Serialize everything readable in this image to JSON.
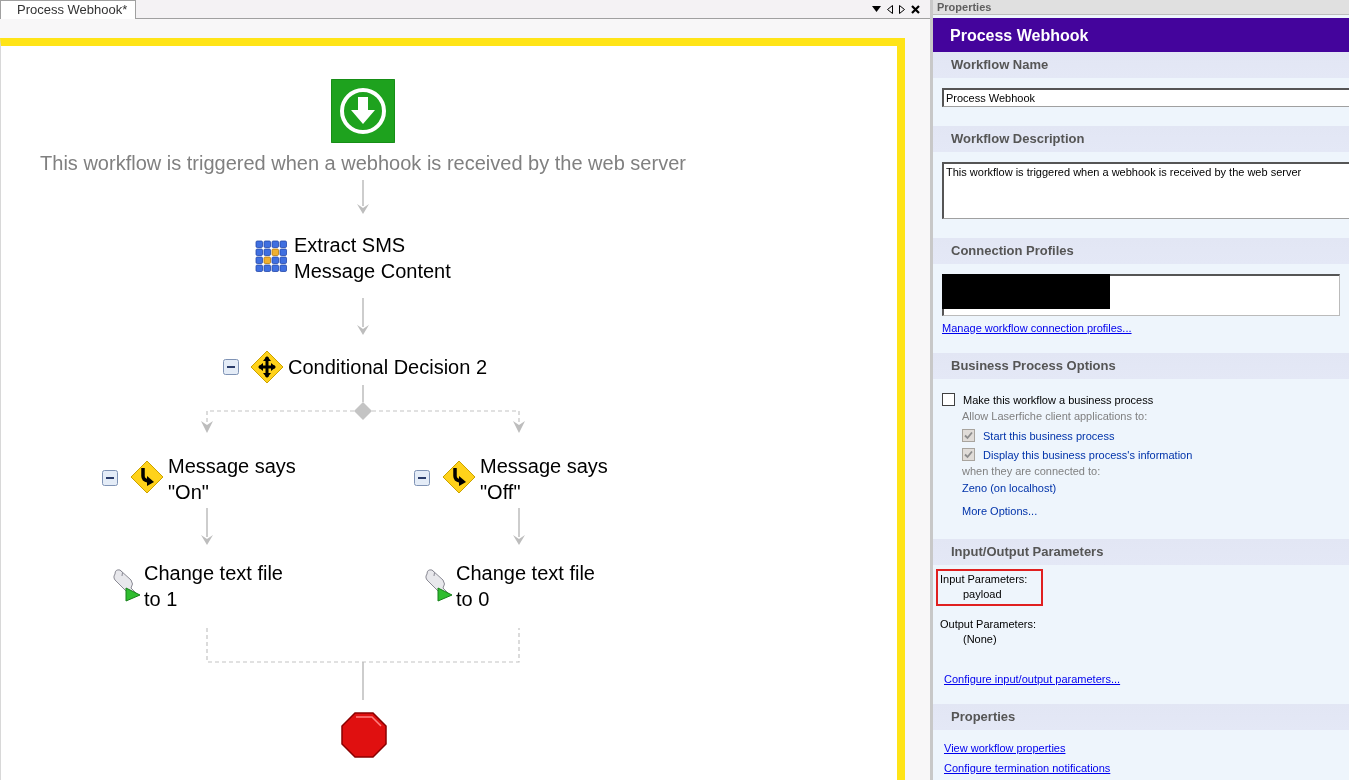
{
  "tab": {
    "label": "Process Webhook*",
    "selected": true
  },
  "diagram": {
    "trigger_caption": "This workflow is triggered when a webhook is received by the web server",
    "steps": [
      {
        "kind": "extract",
        "label": "Extract SMS Message Content"
      },
      {
        "kind": "decision",
        "label": "Conditional Decision 2",
        "expanded": true,
        "branches": [
          {
            "label": "Message says \"On\"",
            "expanded": true,
            "steps": [
              {
                "kind": "script",
                "label": "Change text file to 1"
              }
            ]
          },
          {
            "label": "Message says \"Off\"",
            "expanded": true,
            "steps": [
              {
                "kind": "script",
                "label": "Change text file to 0"
              }
            ]
          }
        ]
      },
      {
        "kind": "stop"
      }
    ]
  },
  "properties": {
    "panel_title": "Properties",
    "heading": "Process Webhook",
    "sections": [
      {
        "kind": "name",
        "title": "Workflow Name",
        "value": "Process Webhook"
      },
      {
        "kind": "description",
        "title": "Workflow Description",
        "value": "This workflow is triggered when a webhook is received by the web server"
      },
      {
        "kind": "connections",
        "title": "Connection Profiles",
        "redacted": true,
        "link": "Manage workflow connection profiles..."
      },
      {
        "kind": "business",
        "title": "Business Process Options",
        "option": {
          "label": "Make this workflow a business process",
          "checked": false
        },
        "allow_label": "Allow Laserfiche client applications to:",
        "permissions": [
          {
            "label": "Start this business process",
            "checked": true,
            "disabled": true
          },
          {
            "label": "Display this business process's information",
            "checked": true,
            "disabled": true
          }
        ],
        "connected_label": "when they are connected to:",
        "server": "Zeno (on localhost)",
        "more": "More Options..."
      },
      {
        "kind": "parameters",
        "title": "Input/Output Parameters",
        "groups": [
          {
            "label": "Input Parameters:",
            "value": "payload",
            "highlighted": true
          },
          {
            "label": "Output Parameters:",
            "value": "(None)",
            "highlighted": false
          }
        ],
        "link": "Configure input/output parameters..."
      },
      {
        "kind": "links",
        "title": "Properties",
        "links": [
          "View workflow properties",
          "Configure termination notifications"
        ]
      }
    ]
  }
}
